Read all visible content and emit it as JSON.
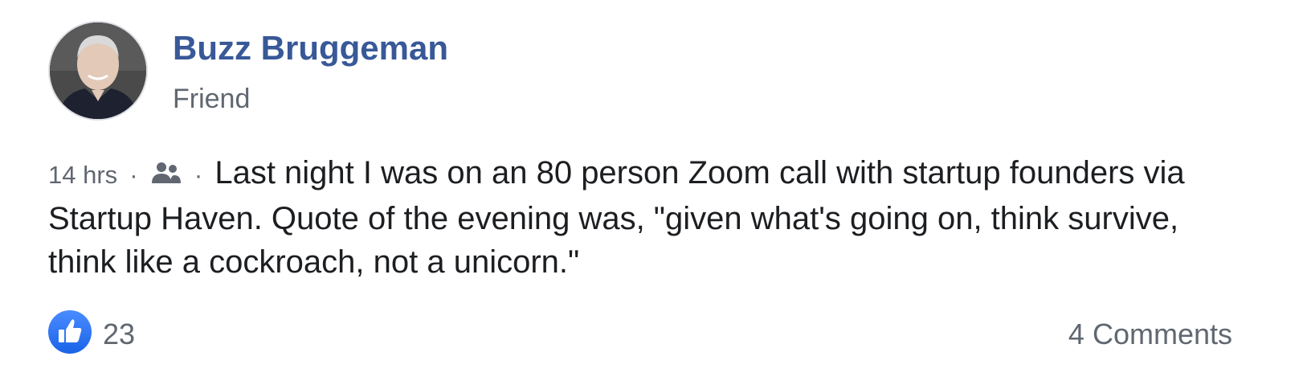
{
  "author": {
    "name": "Buzz Bruggeman",
    "relation": "Friend",
    "avatar_icon": "profile-photo"
  },
  "post": {
    "time": "14 hrs",
    "separator": "·",
    "audience_icon": "friends-icon",
    "text": "Last night I was on an 80 person Zoom call with startup founders via Startup Haven. Quote of the evening was, \"given what's going on, think survive, think like a cockroach, not a unicorn.\""
  },
  "footer": {
    "like_icon": "thumbs-up-icon",
    "like_count": "23",
    "comments_label": "4 Comments"
  },
  "colors": {
    "author_link": "#385898",
    "secondary_text": "#606770",
    "body_text": "#1c1e21",
    "like_blue": "#1a64e8"
  }
}
